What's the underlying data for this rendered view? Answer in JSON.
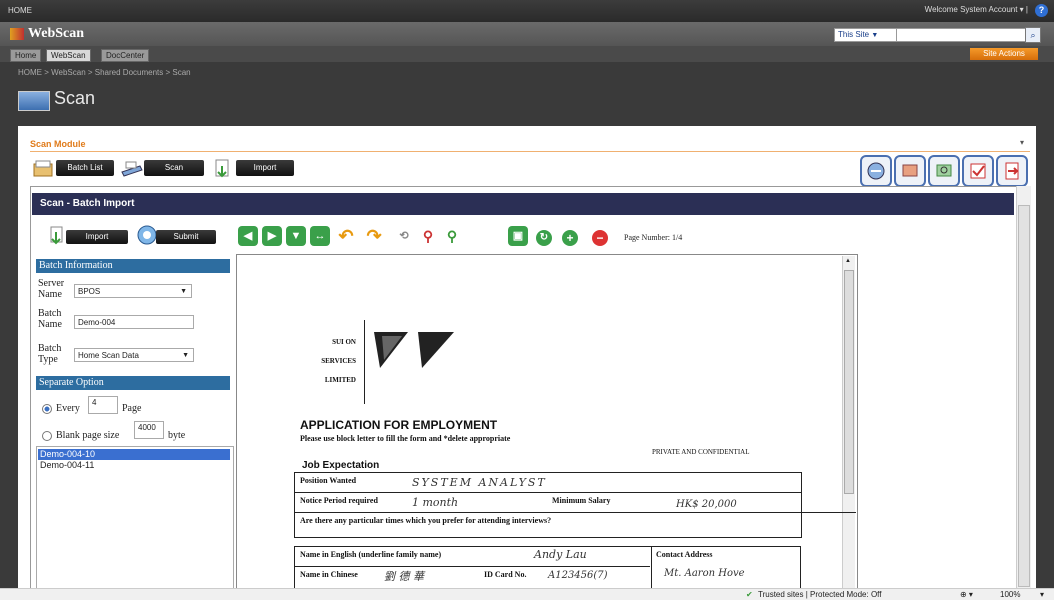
{
  "topbar": {
    "home": "HOME",
    "welcome": "Welcome System Account ▾  |",
    "help": "?"
  },
  "site": {
    "logo": "WebScan",
    "search_scope": "This Site",
    "site_actions": "Site Actions"
  },
  "nav_tabs": [
    "Home",
    "WebScan",
    "DocCenter"
  ],
  "breadcrumb": "HOME > WebScan > Shared Documents > Scan",
  "page_title": "Scan",
  "module": {
    "title": "Scan Module",
    "collapse": "▾"
  },
  "toolbar": {
    "batch_list": "Batch List",
    "scan": "Scan",
    "import": "Import"
  },
  "inner": {
    "header": "Scan - Batch Import",
    "import_btn": "Import",
    "submit_btn": "Submit",
    "page_number": "Page Number: 1/4"
  },
  "batch_info": {
    "section": "Batch Information",
    "server_label": "Server Name",
    "server_value": "BPOS",
    "batch_name_label": "Batch Name",
    "batch_name_value": "Demo-004",
    "batch_type_label": "Batch Type",
    "batch_type_value": "Home Scan Data"
  },
  "separate": {
    "section": "Separate Option",
    "every_label": "Every",
    "every_value": "4",
    "page_label": "Page",
    "blank_label": "Blank page size",
    "blank_value": "4000",
    "byte_label": "byte"
  },
  "batches": [
    "Demo-004-10",
    "Demo-004-11"
  ],
  "document": {
    "company": [
      "SUI ON",
      "SERVICES",
      "LIMITED"
    ],
    "title": "APPLICATION FOR EMPLOYMENT",
    "instruction": "Please use block letter to fill the form and *delete appropriate",
    "confidential": "PRIVATE AND CONFIDENTIAL",
    "section": "Job Expectation",
    "position_label": "Position Wanted",
    "position_value": "SYSTEM ANALYST",
    "notice_label": "Notice Period required",
    "notice_value": "1 month",
    "salary_label": "Minimum Salary",
    "salary_value": "HK$ 20,000",
    "question": "Are there any particular times which you prefer for attending interviews?",
    "name_en_label": "Name in English (underline family name)",
    "name_en_value": "Andy Lau",
    "name_cn_label": "Name in Chinese",
    "name_cn_value": "劉 德 華",
    "id_label": "ID Card No.",
    "id_value": "A123456(7)",
    "contact_label": "Contact Address",
    "contact_value": "Mt. Aaron Hove"
  },
  "status": {
    "zone": "Trusted sites | Protected Mode: Off",
    "zoom": "100%"
  }
}
